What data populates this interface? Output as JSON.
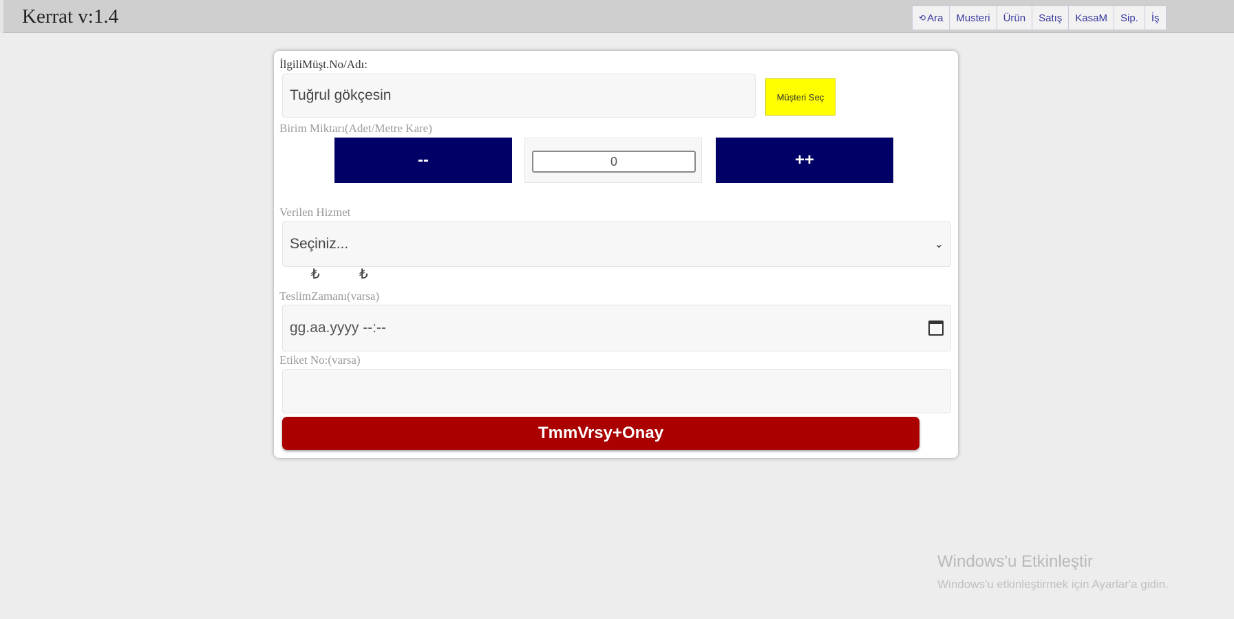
{
  "app": {
    "title": "Kerrat v:1.4"
  },
  "nav": {
    "items": [
      {
        "label": "Ara",
        "arrow": "⟲"
      },
      {
        "label": "Musteri"
      },
      {
        "label": "Ürün"
      },
      {
        "label": "Satış"
      },
      {
        "label": "KasaM"
      },
      {
        "label": "Sip."
      },
      {
        "label": "İş"
      }
    ]
  },
  "form": {
    "customer_label": "İlgiliMüşt.No/Adı:",
    "customer_value": "Tuğrul gökçesin",
    "select_customer_button": "Müşteri Seç",
    "quantity_label": "Birim Miktarı(Adet/Metre Kare)",
    "decrement_label": "--",
    "quantity_value": "0",
    "increment_label": "++",
    "service_label": "Verilen Hizmet",
    "service_selected": "Seçiniz...",
    "price_1": "₺",
    "price_2": "₺",
    "delivery_label": "TeslimZamanı(varsa)",
    "delivery_placeholder": "gg.aa.yyyy --:--",
    "tag_label": "Etiket No:(varsa)",
    "tag_value": "",
    "submit_label": "TmmVrsy+Onay"
  },
  "watermark": {
    "title": "Windows'u Etkinleştir",
    "subtitle": "Windows'u etkinleştirmek için Ayarlar'a gidin."
  },
  "colors": {
    "navy": "#000066",
    "yellow": "#ffff00",
    "red": "#aa0000",
    "nav_text": "#3a3aa0"
  }
}
